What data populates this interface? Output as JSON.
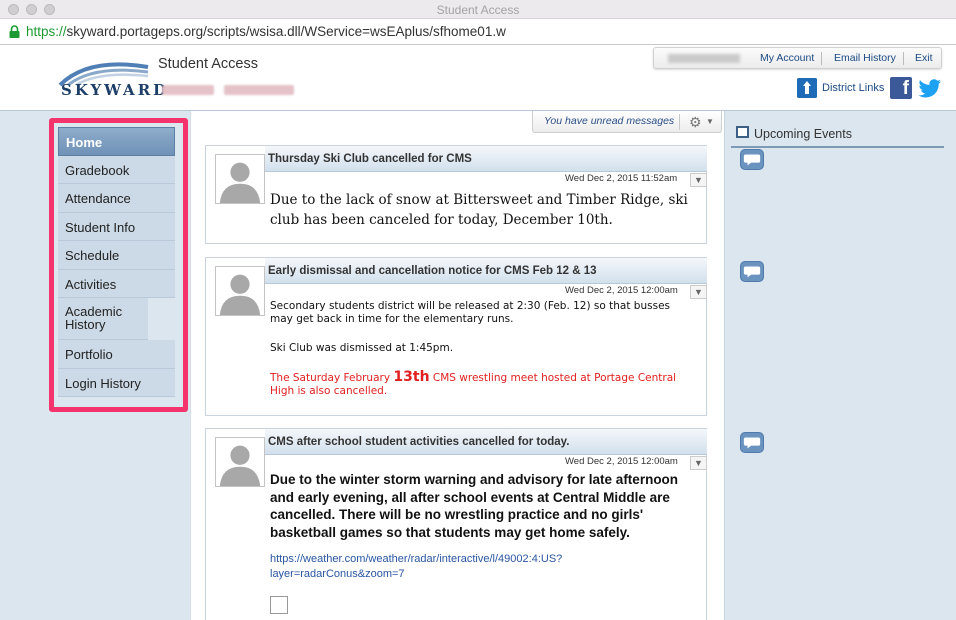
{
  "browser": {
    "window_title": "Student Access",
    "url_protocol": "https://",
    "url_rest": "skyward.portageps.org/scripts/wsisa.dll/WService=wsEAplus/sfhome01.w"
  },
  "header": {
    "logo_text": "SKYWARD",
    "app_title": "Student Access",
    "top_links": [
      "My Account",
      "Email History",
      "Exit"
    ],
    "district_links_label": "District Links"
  },
  "nav": {
    "items": [
      {
        "label": "Home"
      },
      {
        "label": "Gradebook"
      },
      {
        "label": "Attendance"
      },
      {
        "label": "Student Info"
      },
      {
        "label": "Schedule"
      },
      {
        "label": "Activities"
      },
      {
        "label": "Academic History"
      },
      {
        "label": "Portfolio"
      },
      {
        "label": "Login History"
      }
    ]
  },
  "messages_bar": {
    "text": "You have unread messages"
  },
  "posts": [
    {
      "title": "Thursday Ski Club cancelled for CMS",
      "date": "Wed Dec 2, 2015 11:52am",
      "body": "Due to the lack of snow at Bittersweet and Timber Ridge,  ski club has been canceled for today, December 10th."
    },
    {
      "title": "Early dismissal and cancellation notice for CMS Feb 12 & 13",
      "date": "Wed Dec 2, 2015 12:00am",
      "para1": "Secondary students district will be released at 2:30 (Feb. 12) so that busses may get back in time for the elementary runs.",
      "para2": "Ski Club was dismissed at 1:45pm.",
      "para3_a": "The Saturday February ",
      "para3_big": "13th",
      "para3_b": " CMS wrestling meet hosted at Portage Central High is also cancelled."
    },
    {
      "title": "CMS after school student activities cancelled for today.",
      "date": "Wed Dec 2, 2015 12:00am",
      "body": "Due to the winter storm warning and advisory for late afternoon and early evening, all after school events at Central Middle are cancelled. There will be no wrestling practice and no girls' basketball games so that students may get home safely.",
      "link": "https://weather.com/weather/radar/interactive/l/49002:4:US?layer=radarConus&zoom=7"
    }
  ],
  "sidebar_right": {
    "title": "Upcoming Events"
  },
  "colors": {
    "highlight_border": "#f5336d",
    "nav_active": "#7596ba",
    "link": "#1c4a86",
    "alert_red": "#e0201f"
  },
  "icons": [
    "lock-icon",
    "skyward-logo",
    "district-links-icon",
    "facebook-icon",
    "twitter-icon",
    "gear-icon",
    "comment-bubble-icon",
    "avatar-placeholder-icon",
    "calendar-icon",
    "dropdown-arrow-icon"
  ]
}
